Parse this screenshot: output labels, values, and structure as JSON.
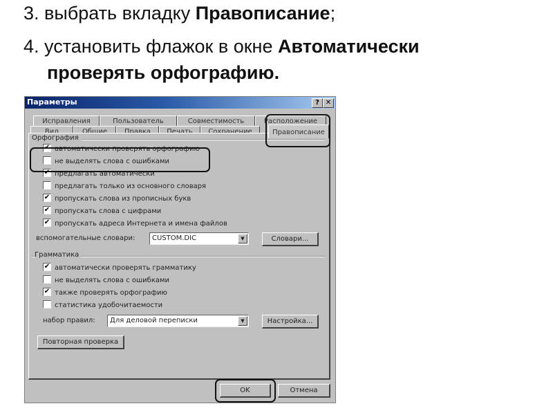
{
  "instructions": {
    "step3_prefix": "3. выбрать вкладку ",
    "step3_bold": "Правописание",
    "step3_suffix": ";",
    "step4_prefix": "4. установить флажок в окне ",
    "step4_bold_line1": "Автоматически",
    "step4_bold_line2": "проверять орфографию",
    "step4_suffix": "."
  },
  "dialog": {
    "title": "Параметры",
    "help_button": "?",
    "close_button": "✕",
    "tabs_row1": [
      "Исправления",
      "Пользователь",
      "Совместимость",
      "Расположение"
    ],
    "tabs_row2": [
      "Вид",
      "Общие",
      "Правка",
      "Печать",
      "Сохранение",
      "Правописание"
    ],
    "active_tab": "Правописание",
    "spelling": {
      "group_label": "Орфография",
      "options": [
        {
          "label": "автоматически проверять орфографию",
          "checked": true
        },
        {
          "label": "не выделять слова с ошибками",
          "checked": false
        },
        {
          "label": "предлагать автоматически",
          "checked": true
        },
        {
          "label": "предлагать только из основного словаря",
          "checked": false
        },
        {
          "label": "пропускать слова из прописных букв",
          "checked": true
        },
        {
          "label": "пропускать слова с цифрами",
          "checked": true
        },
        {
          "label": "пропускать адреса Интернета и имена файлов",
          "checked": true
        }
      ],
      "custom_dict_label": "вспомогательные словари:",
      "custom_dict_value": "CUSTOM.DIC",
      "dictionaries_button": "Словари..."
    },
    "grammar": {
      "group_label": "Грамматика",
      "options": [
        {
          "label": "автоматически проверять грамматику",
          "checked": true
        },
        {
          "label": "не выделять слова с ошибками",
          "checked": false
        },
        {
          "label": "также проверять орфографию",
          "checked": true
        },
        {
          "label": "статистика удобочитаемости",
          "checked": false
        }
      ],
      "ruleset_label": "набор правил:",
      "ruleset_value": "Для деловой переписки",
      "settings_button": "Настройка..."
    },
    "recheck_button": "Повторная проверка",
    "ok_button": "OK",
    "cancel_button": "Отмена",
    "check_mark": "✔",
    "dropdown_arrow": "▼"
  }
}
